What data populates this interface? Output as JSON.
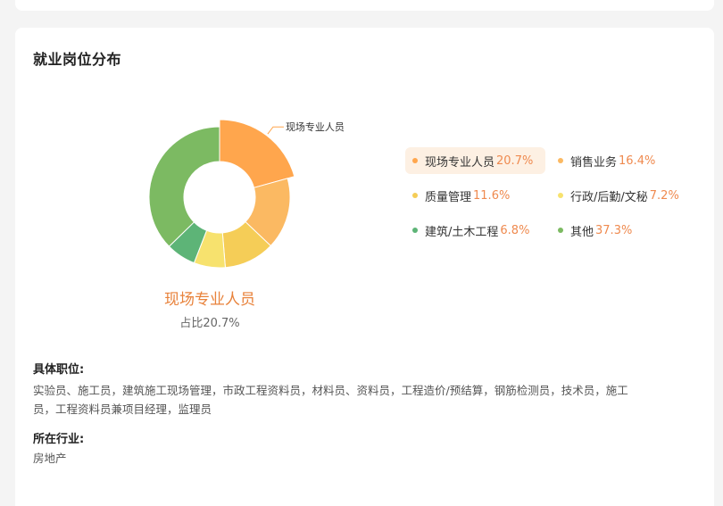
{
  "card": {
    "title": "就业岗位分布"
  },
  "chart_data": {
    "type": "pie",
    "variant": "donut",
    "categories": [
      "现场专业人员",
      "销售业务",
      "质量管理",
      "行政/后勤/文秘",
      "建筑/土木工程",
      "其他"
    ],
    "values": [
      20.7,
      16.4,
      11.6,
      7.2,
      6.8,
      37.3
    ],
    "colors": [
      "#ffa64d",
      "#fbb962",
      "#f5cd57",
      "#f7e26e",
      "#5db477",
      "#7cba62"
    ],
    "value_labels": [
      "20.7%",
      "16.4%",
      "11.6%",
      "7.2%",
      "6.8%",
      "37.3%"
    ],
    "highlighted_index": 0,
    "callout_label": "现场专业人员",
    "legend_placement": "right"
  },
  "selected": {
    "name": "现场专业人员",
    "share": "占比20.7%"
  },
  "details": {
    "positions_title": "具体职位:",
    "positions_line1": "实验员、施工员，建筑施工现场管理，市政工程资料员，材料员、资料员，工程造价/预结算，钢筋检测员，技术员，施工",
    "positions_line2": "员，工程资料员兼项目经理，监理员",
    "industry_title": "所在行业:",
    "industry_text": "房地产"
  }
}
